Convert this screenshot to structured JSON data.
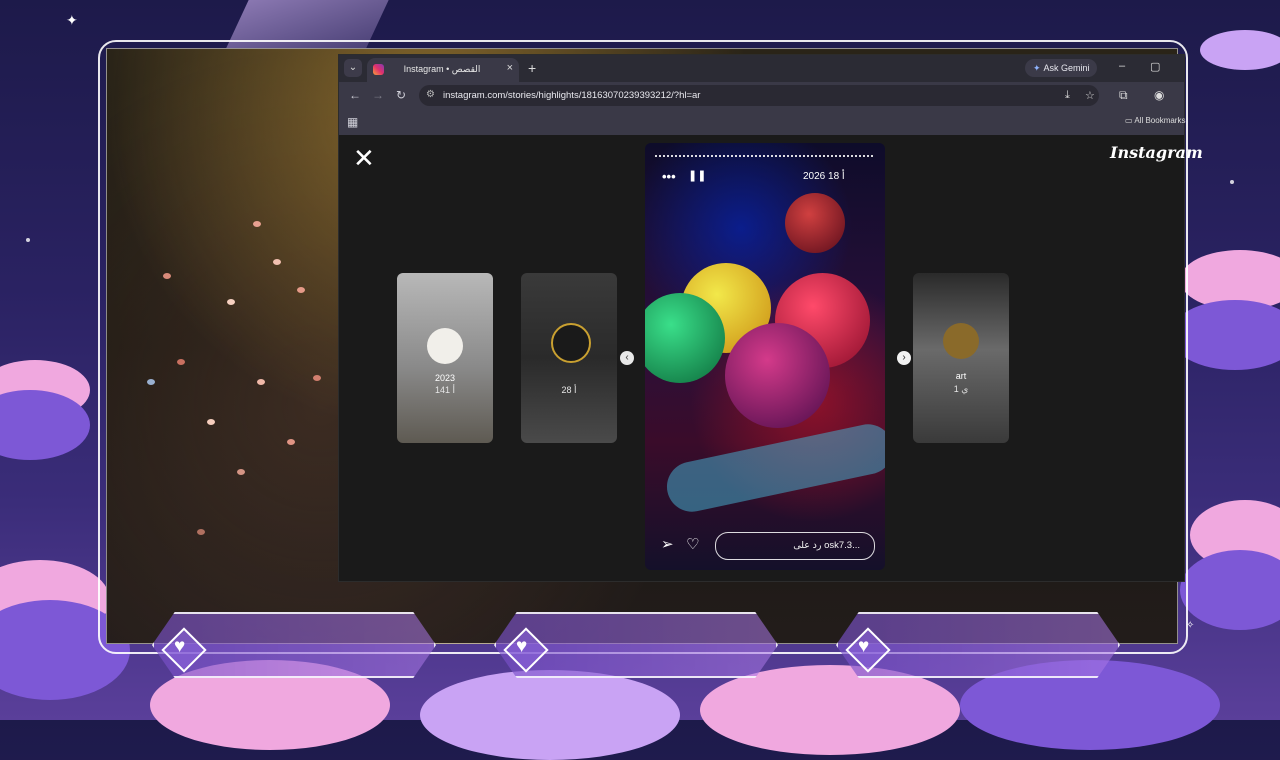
{
  "browser": {
    "tab_title": "Instagram • القصص",
    "tab_close": "×",
    "new_tab": "+",
    "tab_menu": "⌄",
    "gemini_label": "Ask Gemini",
    "minimize": "–",
    "maximize": "▢",
    "url": "instagram.com/stories/highlights/18163070239393212/?hl=ar",
    "all_bookmarks": "All Bookmarks"
  },
  "page": {
    "logo": "Instagram",
    "close": "✕"
  },
  "highlights": [
    {
      "label": "2023",
      "sub": "141 أ"
    },
    {
      "label": "",
      "sub": "28 أ"
    },
    {
      "label": "art",
      "sub": "1 ي"
    }
  ],
  "story": {
    "date": "2026 أ 18",
    "reply_placeholder": "رد على osk7.3...",
    "more": "•••",
    "pause": "❚❚"
  },
  "icons": {
    "back": "←",
    "forward": "→",
    "reload": "↻",
    "site_info": "⚙",
    "install": "⤓",
    "star": "☆",
    "extensions": "⧉",
    "profile": "◉",
    "apps": "▦",
    "folder": "▭",
    "share": "➢",
    "like": "♡",
    "prev": "‹",
    "next": "›",
    "heart": "♥"
  }
}
